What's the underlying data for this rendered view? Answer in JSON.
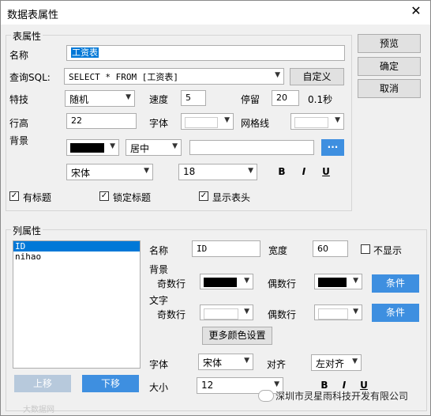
{
  "window": {
    "title": "数据表属性",
    "close": "✕"
  },
  "table_group": {
    "title": "表属性"
  },
  "labels": {
    "name": "名称",
    "query": "查询SQL:",
    "effect": "特技",
    "speed": "速度",
    "stay": "停留",
    "stay_unit": "0.1秒",
    "row_height": "行高",
    "font": "字体",
    "grid": "网格线",
    "background": "背景"
  },
  "values": {
    "name": "工资表",
    "query": "SELECT * FROM [工资表]",
    "effect": "随机",
    "speed": "5",
    "stay": "20",
    "row_height": "22",
    "align": "居中",
    "font_name": "宋体",
    "font_size": "18",
    "ellipsis": "···"
  },
  "side_buttons": {
    "preview": "预览",
    "ok": "确定",
    "cancel": "取消",
    "custom": "自定义"
  },
  "format": {
    "bold": "B",
    "italic": "I",
    "underline": "U"
  },
  "checks": {
    "has_title": "有标题",
    "lock_title": "锁定标题",
    "show_header": "显示表头"
  },
  "col_group": {
    "title": "列属性"
  },
  "col_list": [
    "ID",
    "nihao"
  ],
  "col_labels": {
    "name": "名称",
    "width": "宽度",
    "hide": "不显示",
    "background": "背景",
    "odd_row": "奇数行",
    "even_row": "偶数行",
    "text": "文字",
    "more_colors": "更多颜色设置",
    "font": "字体",
    "align": "对齐",
    "size": "大小",
    "condition": "条件",
    "move_up": "上移",
    "move_down": "下移"
  },
  "col_values": {
    "name": "ID",
    "width": "60",
    "font": "宋体",
    "align": "左对齐",
    "size": "12"
  },
  "watermark": {
    "text": "深圳市灵星雨科技开发有限公司",
    "corner": "大数据网"
  },
  "colors": {
    "accent": "#3e8fe0",
    "selection": "#0078d7"
  }
}
